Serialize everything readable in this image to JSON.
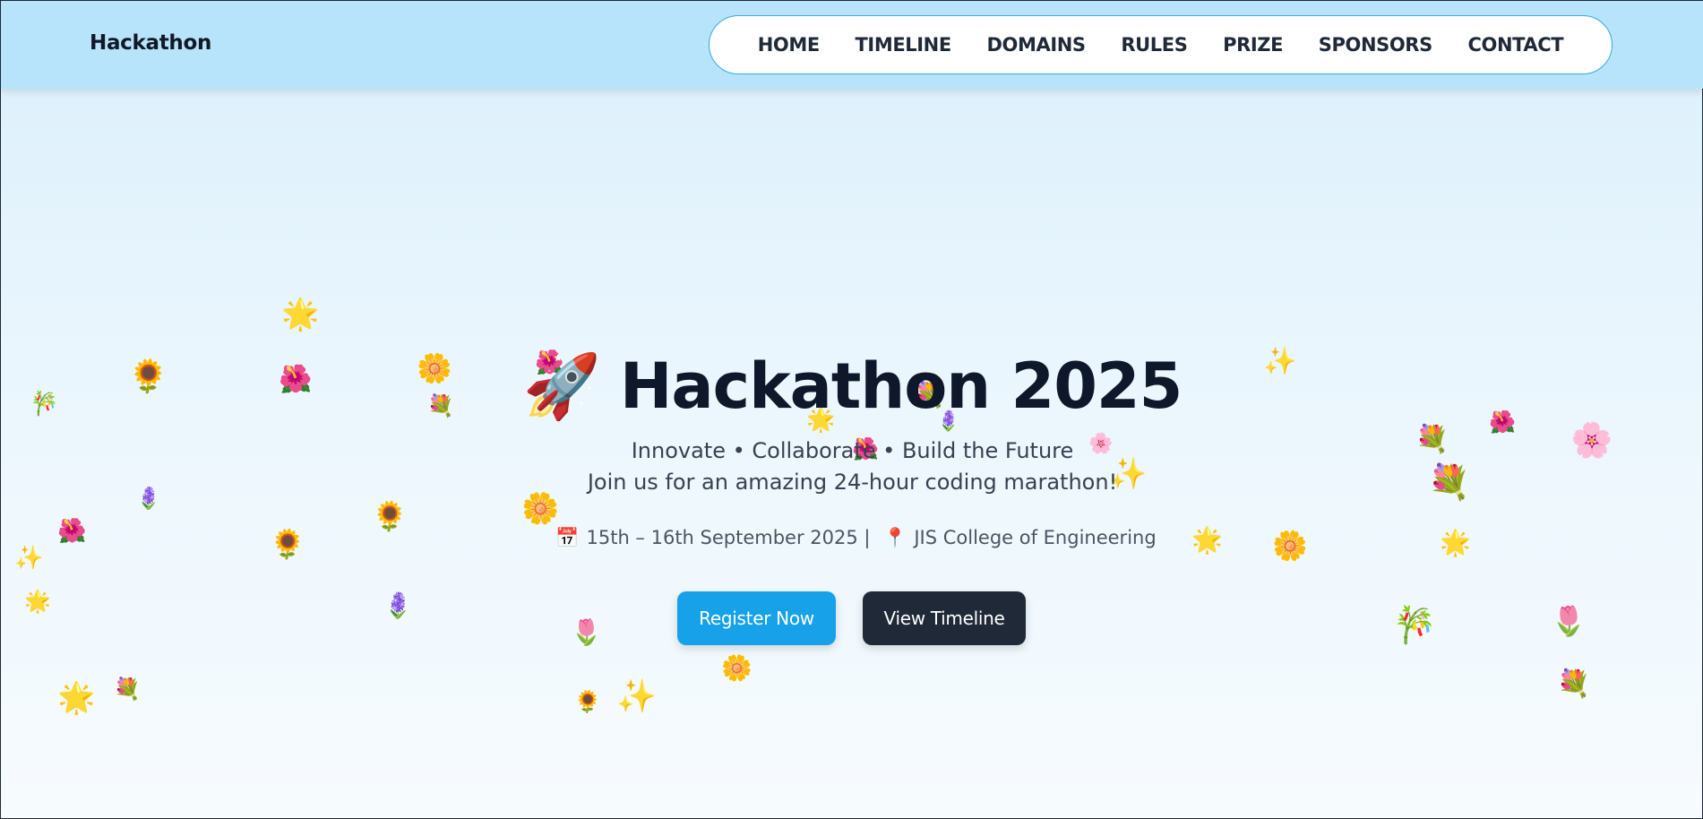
{
  "brand": "Hackathon",
  "nav": [
    "HOME",
    "TIMELINE",
    "DOMAINS",
    "RULES",
    "PRIZE",
    "SPONSORS",
    "CONTACT"
  ],
  "hero": {
    "rocket_icon": "🚀",
    "title": "Hackathon 2025",
    "tagline": "Innovate • Collaborate • Build the Future",
    "subtitle": "Join us for an amazing 24-hour coding marathon!",
    "calendar_icon": "📅",
    "date": "15th – 16th September 2025 |",
    "pin_icon": "📍",
    "venue": "JIS College of Engineering",
    "register_label": "Register Now",
    "timeline_label": "View Timeline"
  },
  "decorations": [
    "🌻",
    "🌸",
    "🌼",
    "🌺",
    "💐",
    "🌟",
    "🌷",
    "✨",
    "🎋",
    "🪻"
  ],
  "colors": {
    "nav_bg": "#b8e4fb",
    "accent": "#16a1e8",
    "dark_button": "#1f2937",
    "pill_border": "#38a9dd",
    "title": "#0f172a"
  }
}
